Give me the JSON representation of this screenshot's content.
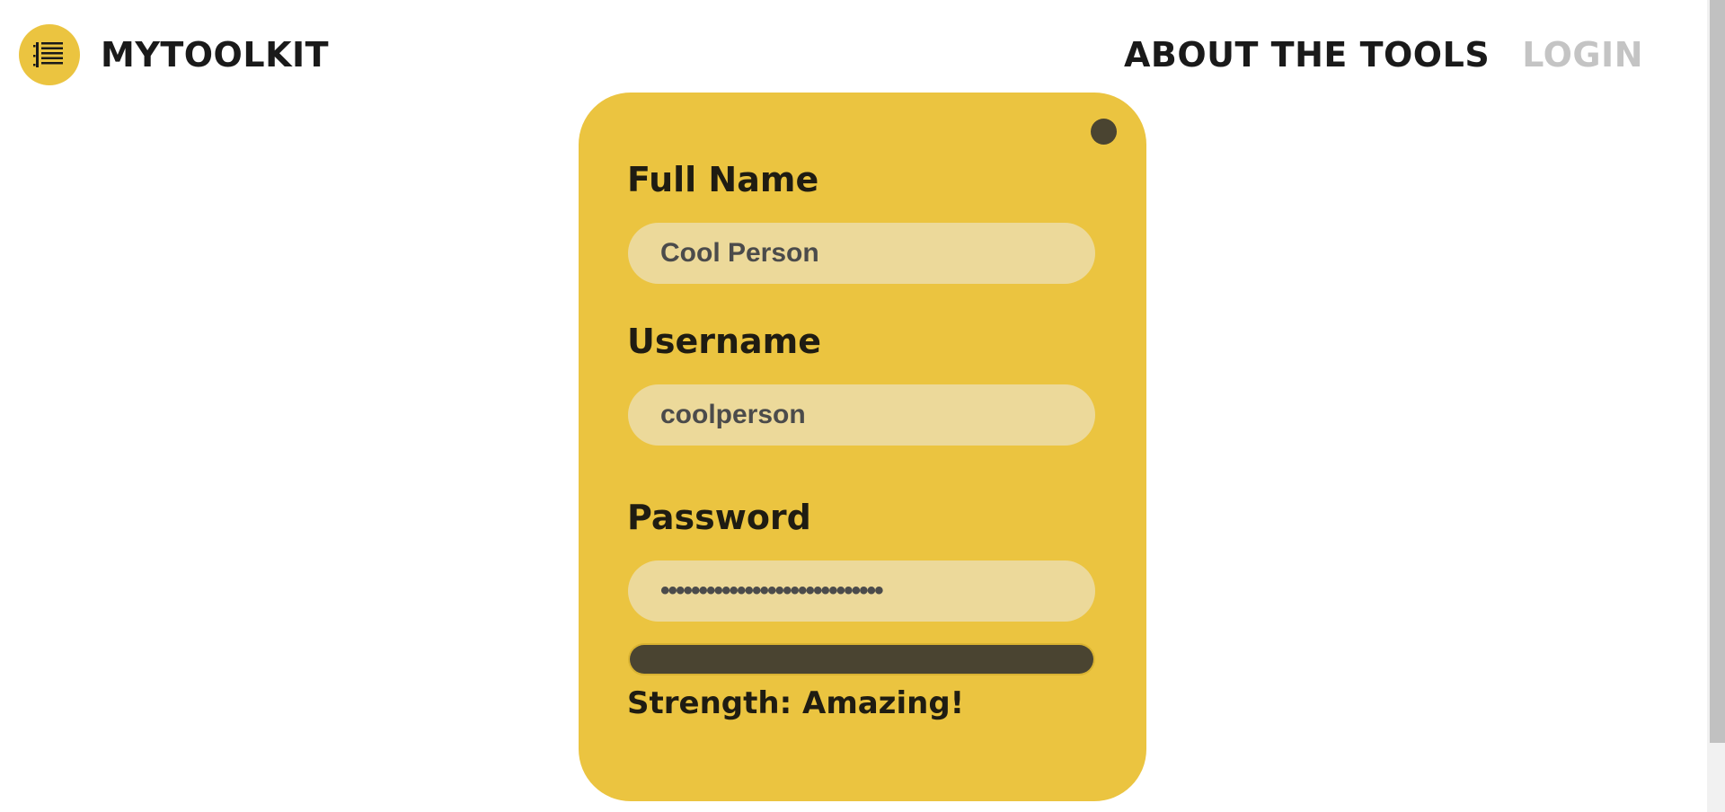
{
  "colors": {
    "accent": "#ebc440",
    "field_bg": "#ecd99a",
    "dark": "#4a4431",
    "nav_active": "#1a1a1a",
    "nav_inactive": "#c4c4c4"
  },
  "header": {
    "logo_icon": "list-icon",
    "brand": "MYTOOLKIT",
    "nav": {
      "about": "ABOUT THE TOOLS",
      "login": "LOGIN"
    }
  },
  "form": {
    "close_icon": "close-dot-icon",
    "full_name": {
      "label": "Full Name",
      "value": "Cool Person"
    },
    "username": {
      "label": "Username",
      "value": "coolperson"
    },
    "password": {
      "label": "Password",
      "value": "•••••••••••••••••••••••••••••"
    },
    "strength": {
      "level": 1.0,
      "text": "Strength: Amazing!"
    }
  }
}
